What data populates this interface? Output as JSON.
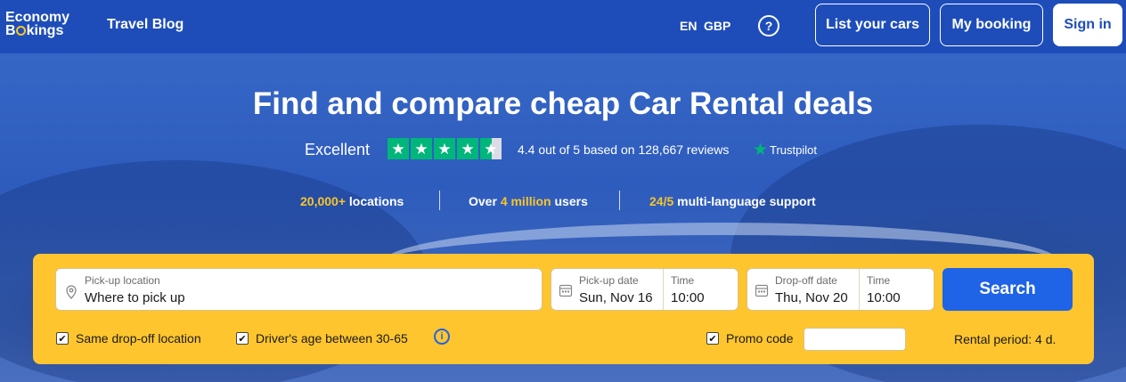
{
  "header": {
    "logo_line1": "Economy",
    "logo_line2_pre": "B",
    "logo_line2_post": "kings",
    "travel_blog": "Travel Blog",
    "language": "EN",
    "currency": "GBP",
    "help_icon": "?",
    "list_cars": "List your cars",
    "my_booking": "My booking",
    "sign_in": "Sign in"
  },
  "hero": {
    "title": "Find and compare cheap Car Rental deals",
    "rating_word": "Excellent",
    "rating_value": 4.4,
    "rating_max": 5,
    "rating_text": "4.4 out of 5 based on 128,667 reviews",
    "trustpilot": "Trustpilot",
    "stats": [
      {
        "highlight": "20,000+",
        "suffix": " locations",
        "prefix": ""
      },
      {
        "prefix": "Over ",
        "highlight": "4 million",
        "suffix": " users"
      },
      {
        "prefix": "",
        "highlight": "24/5",
        "suffix": " multi-language support"
      }
    ]
  },
  "search": {
    "pickup_location_label": "Pick-up location",
    "pickup_location_placeholder": "Where to pick up",
    "pickup_date_label": "Pick-up date",
    "pickup_date_value": "Sun, Nov 16",
    "pickup_time_label": "Time",
    "pickup_time_value": "10:00",
    "dropoff_date_label": "Drop-off date",
    "dropoff_date_value": "Thu, Nov 20",
    "dropoff_time_label": "Time",
    "dropoff_time_value": "10:00",
    "search_button": "Search",
    "same_dropoff_label": "Same drop-off location",
    "same_dropoff_checked": true,
    "driver_age_label": "Driver's age between 30-65",
    "driver_age_checked": true,
    "info_icon": "i",
    "promo_code_label": "Promo code",
    "promo_code_checked": true,
    "promo_code_value": "",
    "rental_period": "Rental period: 4 d."
  },
  "colors": {
    "header_bg": "#1e4dba",
    "panel_bg": "#fec52e",
    "search_button": "#1f63e6",
    "trustpilot_green": "#00b67a",
    "highlight_yellow": "#f7c52b"
  }
}
